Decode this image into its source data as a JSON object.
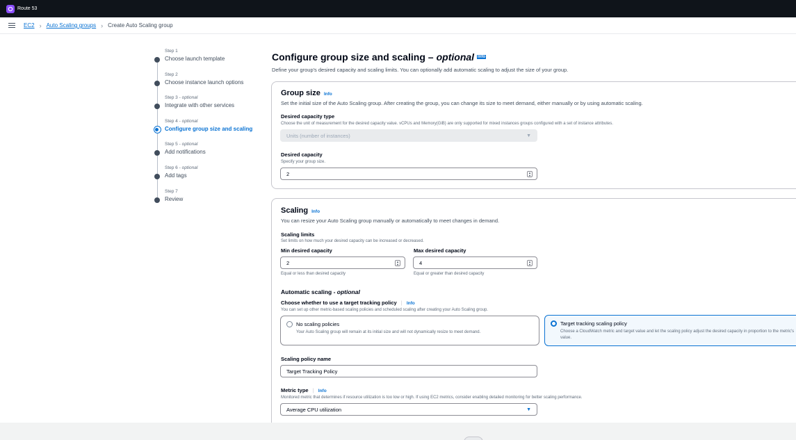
{
  "topbar": {
    "service_name": "Route 53",
    "icon": "route53-icon"
  },
  "breadcrumb": {
    "items": [
      "EC2",
      "Auto Scaling groups"
    ],
    "current": "Create Auto Scaling group"
  },
  "steps": [
    {
      "num": "Step 1",
      "optional": "",
      "title": "Choose launch template",
      "active": false
    },
    {
      "num": "Step 2",
      "optional": "",
      "title": "Choose instance launch options",
      "active": false
    },
    {
      "num": "Step 3",
      "optional": "optional",
      "title": "Integrate with other services",
      "active": false
    },
    {
      "num": "Step 4",
      "optional": "optional",
      "title": "Configure group size and scaling",
      "active": true
    },
    {
      "num": "Step 5",
      "optional": "optional",
      "title": "Add notifications",
      "active": false
    },
    {
      "num": "Step 6",
      "optional": "optional",
      "title": "Add tags",
      "active": false
    },
    {
      "num": "Step 7",
      "optional": "",
      "title": "Review",
      "active": false
    }
  ],
  "page": {
    "title": "Configure group size and scaling",
    "title_optional": "optional",
    "info": "Info",
    "description": "Define your group's desired capacity and scaling limits. You can optionally add automatic scaling to adjust the size of your group."
  },
  "group_size": {
    "title": "Group size",
    "info": "Info",
    "description": "Set the initial size of the Auto Scaling group. After creating the group, you can change its size to meet demand, either manually or by using automatic scaling.",
    "capacity_type_label": "Desired capacity type",
    "capacity_type_hint": "Choose the unit of measurement for the desired capacity value. vCPUs and Memory(GiB) are only supported for mixed instances groups configured with a set of instance attributes.",
    "capacity_type_value": "Units (number of instances)",
    "desired_label": "Desired capacity",
    "desired_hint": "Specify your group size.",
    "desired_value": "2"
  },
  "scaling": {
    "title": "Scaling",
    "info": "Info",
    "description": "You can resize your Auto Scaling group manually or automatically to meet changes in demand.",
    "limits_label": "Scaling limits",
    "limits_hint": "Set limits on how much your desired capacity can be increased or decreased.",
    "min_label": "Min desired capacity",
    "min_value": "2",
    "min_hint": "Equal or less than desired capacity",
    "max_label": "Max desired capacity",
    "max_value": "4",
    "max_hint": "Equal or greater than desired capacity",
    "auto_label": "Automatic scaling - ",
    "auto_optional": "optional",
    "choose_label": "Choose whether to use a target tracking policy",
    "choose_info": "Info",
    "choose_hint": "You can set up other metric-based scaling policies and scheduled scaling after creating your Auto Scaling group.",
    "option_none_title": "No scaling policies",
    "option_none_desc": "Your Auto Scaling group will remain at its initial size and will not dynamically resize to meet demand.",
    "option_target_title": "Target tracking scaling policy",
    "option_target_desc": "Choose a CloudWatch metric and target value and let the scaling policy adjust the desired capacity in proportion to the metric's value.",
    "policy_name_label": "Scaling policy name",
    "policy_name_value": "Target Tracking Policy",
    "metric_label": "Metric type",
    "metric_info": "Info",
    "metric_hint": "Monitored metric that determines if resource utilization is too low or high. If using EC2 metrics, consider enabling detailed monitoring for better scaling performance.",
    "metric_value": "Average CPU utilization"
  }
}
